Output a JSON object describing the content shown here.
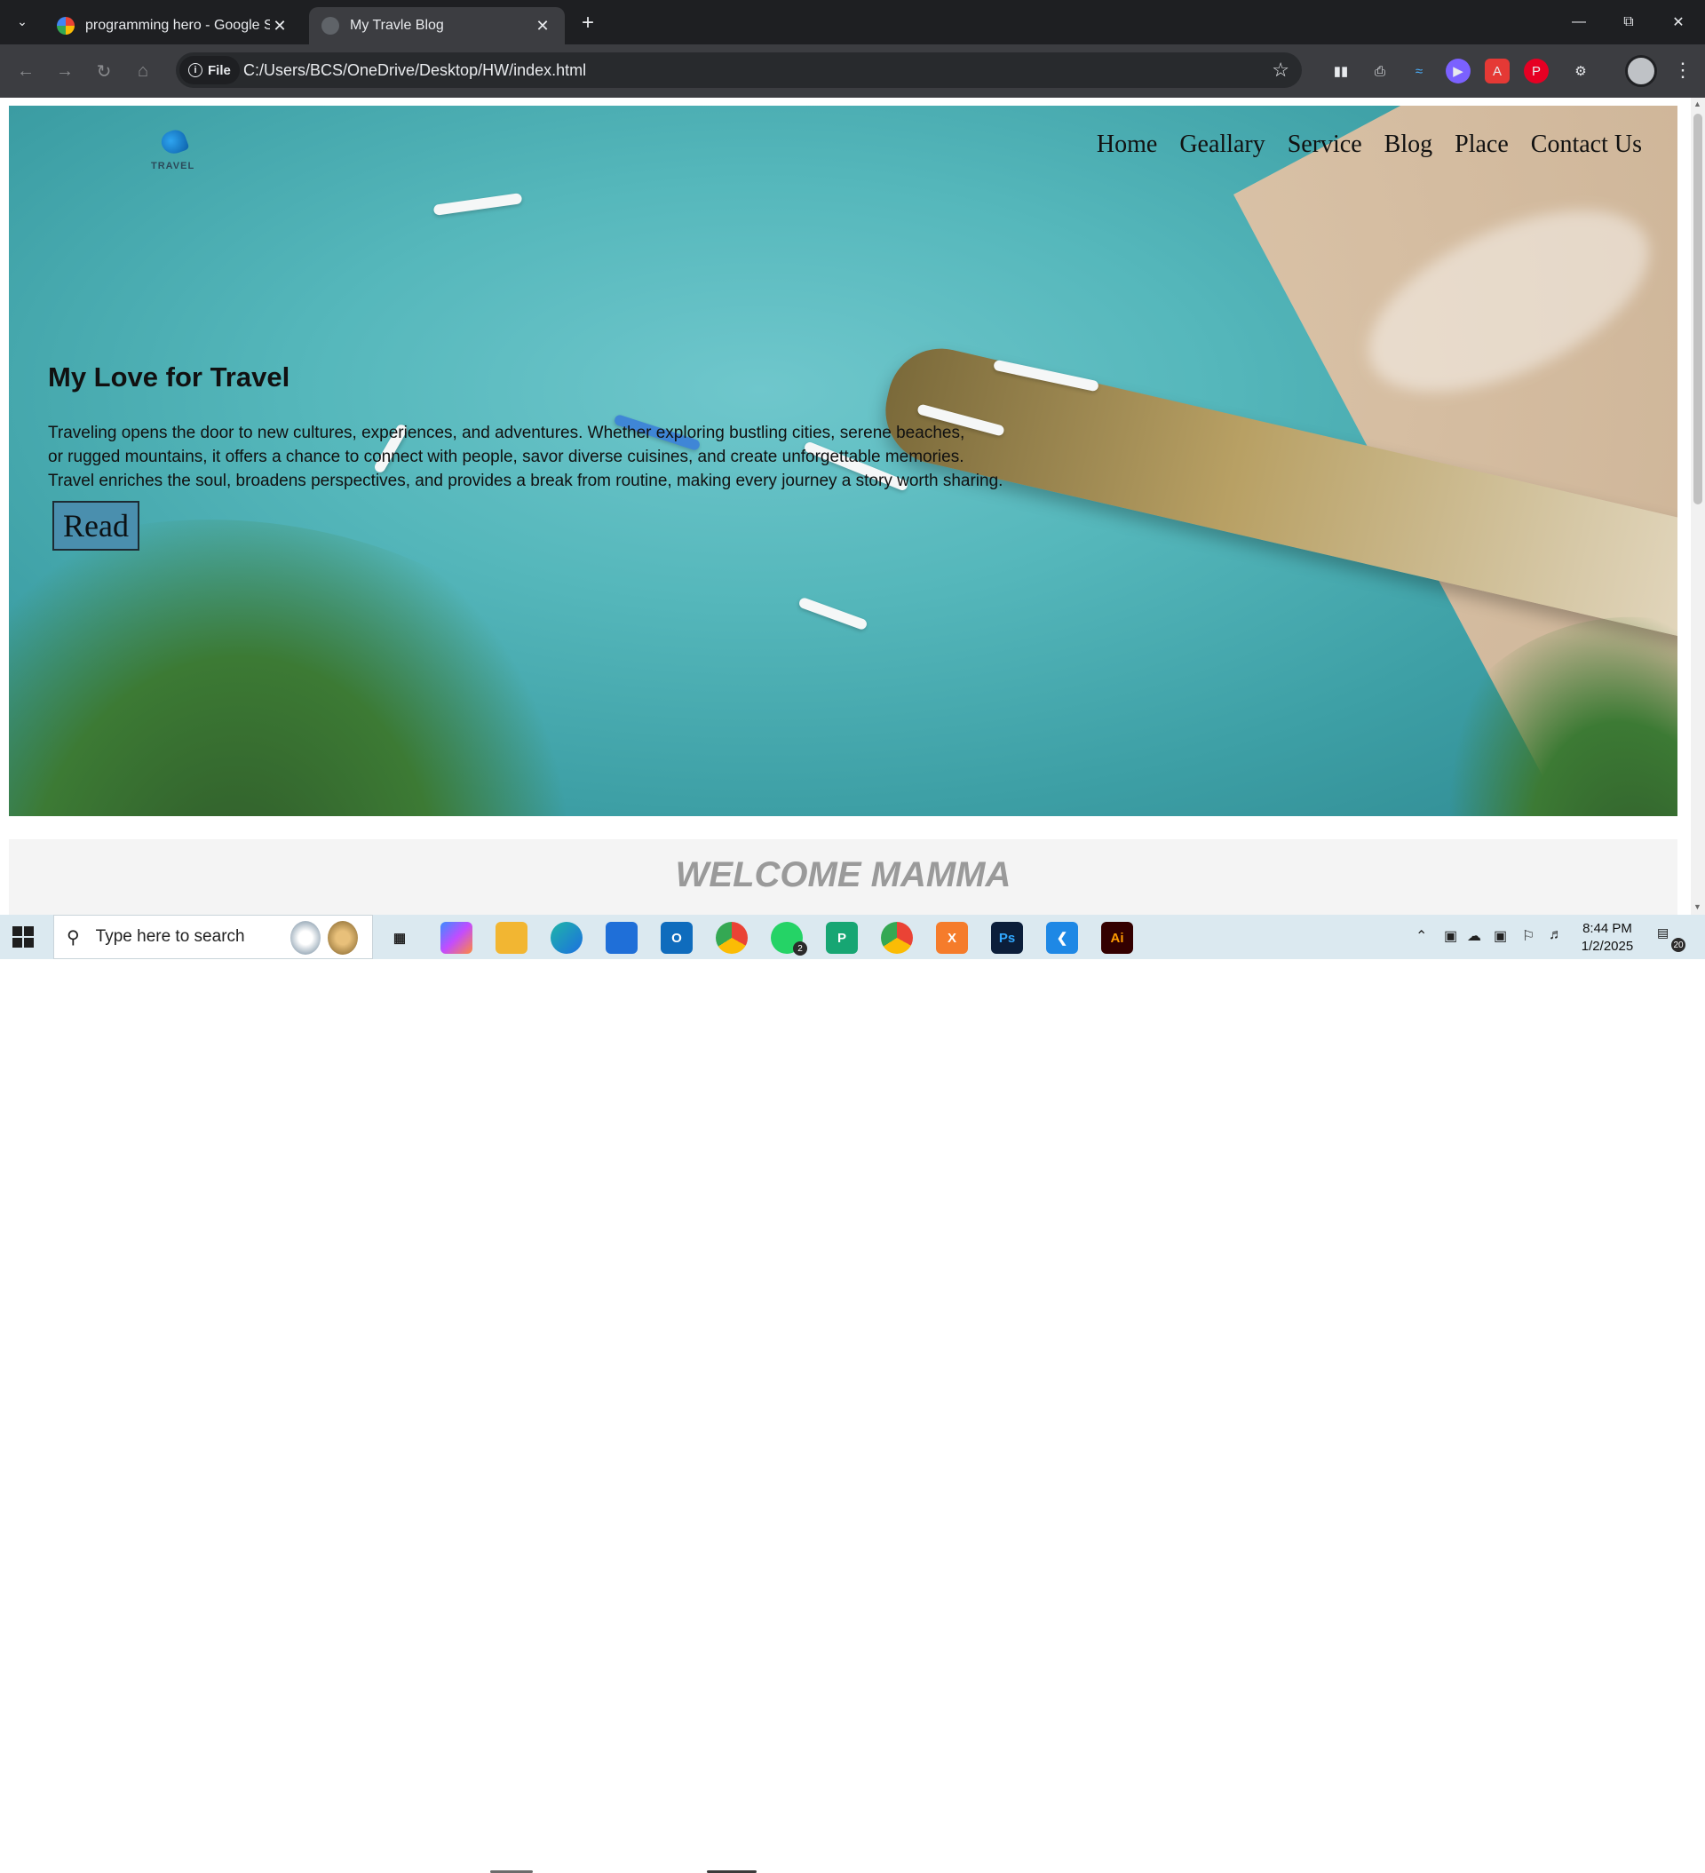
{
  "browser": {
    "tabs": [
      {
        "title": "programming hero - Google Se",
        "active": false
      },
      {
        "title": "My Travle Blog",
        "active": true
      }
    ],
    "url_scheme_label": "File",
    "url": "C:/Users/BCS/OneDrive/Desktop/HW/index.html"
  },
  "page": {
    "logo_text": "TRAVEL",
    "nav": [
      "Home",
      "Geallary",
      "Service",
      "Blog",
      "Place",
      "Contact Us"
    ],
    "hero": {
      "title": "My Love for Travel",
      "paragraph_lines": [
        "Traveling opens the door to new cultures, experiences, and adventures. Whether exploring bustling cities, serene beaches,",
        "or rugged mountains, it offers a chance to connect with people, savor diverse cuisines, and create unforgettable memories.",
        "Travel enriches the soul, broadens perspectives, and provides a break from routine, making every journey a story worth sharing."
      ],
      "button_label": "Read"
    },
    "welcome_heading": "WELCOME MAMMA"
  },
  "taskbar": {
    "search_placeholder": "Type here to search",
    "whatsapp_badge": "2",
    "time": "8:44 PM",
    "date": "1/2/2025",
    "notification_count": "20"
  }
}
